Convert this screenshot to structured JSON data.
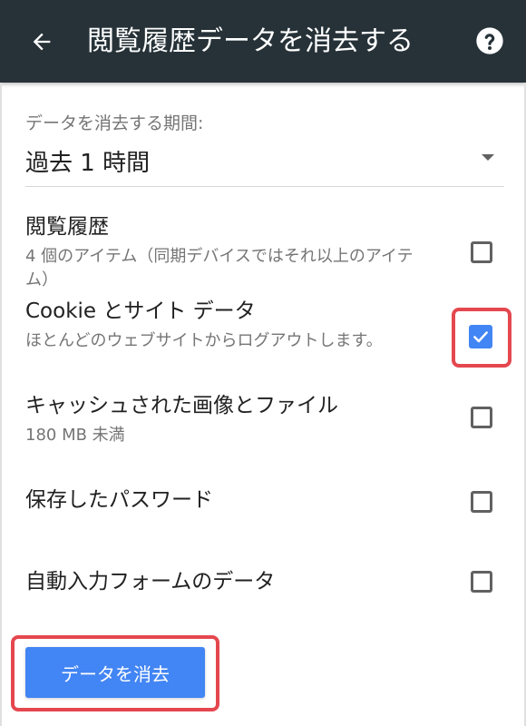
{
  "appbar": {
    "title": "閲覧履歴データを消去する",
    "back_icon": "arrow-back-icon",
    "help_icon": "help-icon",
    "background": "#263238"
  },
  "period": {
    "label": "データを消去する期間:",
    "value": "過去 1 時間",
    "dropdown_icon": "dropdown-arrow-icon"
  },
  "options": [
    {
      "title": "閲覧履歴",
      "subtitle": "4 個のアイテム（同期デバイスではそれ以上のアイテム）",
      "checked": false
    },
    {
      "title": "Cookie とサイト データ",
      "subtitle": "ほとんどのウェブサイトからログアウトします。",
      "checked": true
    },
    {
      "title": "キャッシュされた画像とファイル",
      "subtitle": "180 MB 未満",
      "checked": false
    },
    {
      "title": "保存したパスワード",
      "subtitle": "",
      "checked": false
    },
    {
      "title": "自動入力フォームのデータ",
      "subtitle": "",
      "checked": false
    }
  ],
  "clear_button": {
    "label": "データを消去"
  },
  "colors": {
    "accent": "#4285f4",
    "highlight": "#e5474f"
  }
}
